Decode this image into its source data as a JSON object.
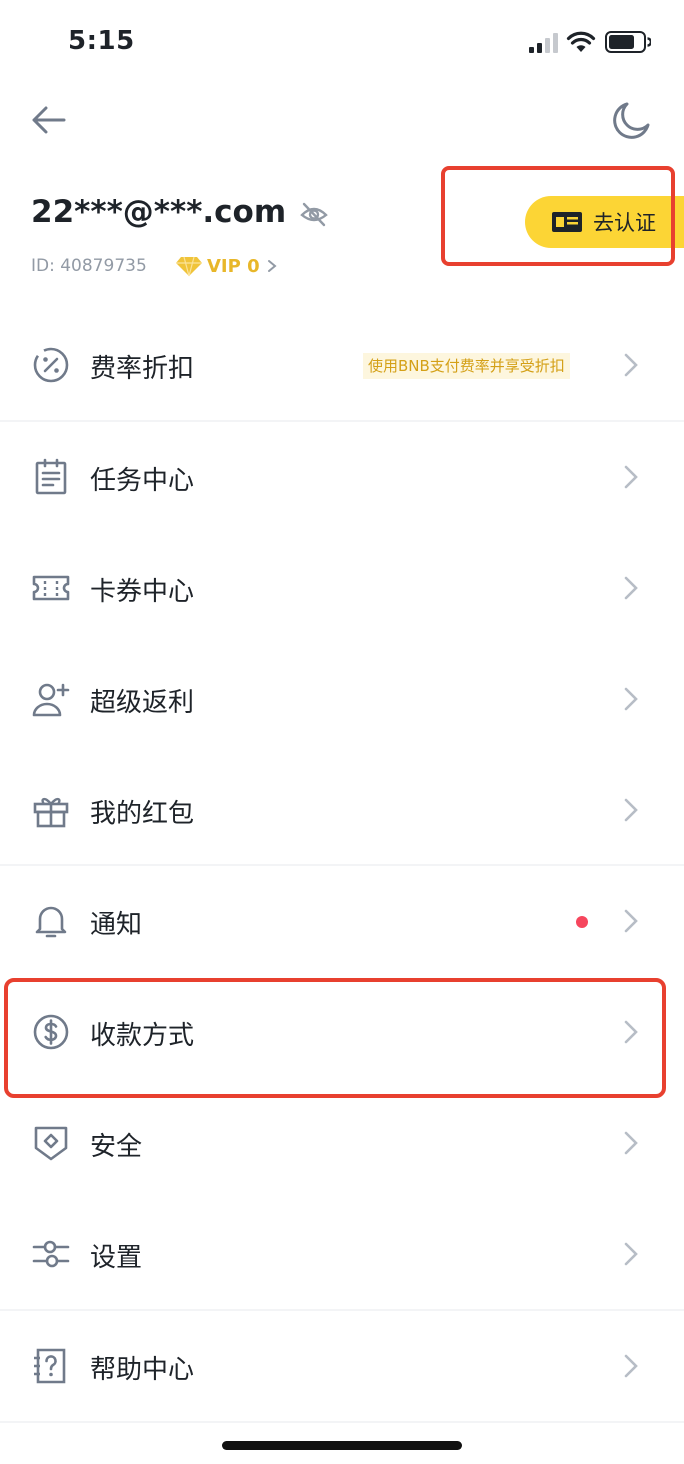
{
  "status_bar": {
    "time": "5:15"
  },
  "profile": {
    "email": "22***@***.com",
    "user_id": "ID: 40879735",
    "vip_label": "VIP 0",
    "verify_label": "去认证"
  },
  "menu": {
    "fee_discount": {
      "label": "费率折扣",
      "promo": "使用BNB支付费率并享受折扣"
    },
    "task_center": {
      "label": "任务中心"
    },
    "coupon_center": {
      "label": "卡券中心"
    },
    "super_rebate": {
      "label": "超级返利"
    },
    "red_packet": {
      "label": "我的红包"
    },
    "notifications": {
      "label": "通知"
    },
    "payment_methods": {
      "label": "收款方式"
    },
    "security": {
      "label": "安全"
    },
    "settings": {
      "label": "设置"
    },
    "help_center": {
      "label": "帮助中心"
    }
  },
  "colors": {
    "accent_yellow": "#fcd535",
    "highlight_red": "#e8402f",
    "notice_dot": "#f6465d",
    "vip_gold": "#e8b72a",
    "icon_gray": "#707a8a"
  }
}
